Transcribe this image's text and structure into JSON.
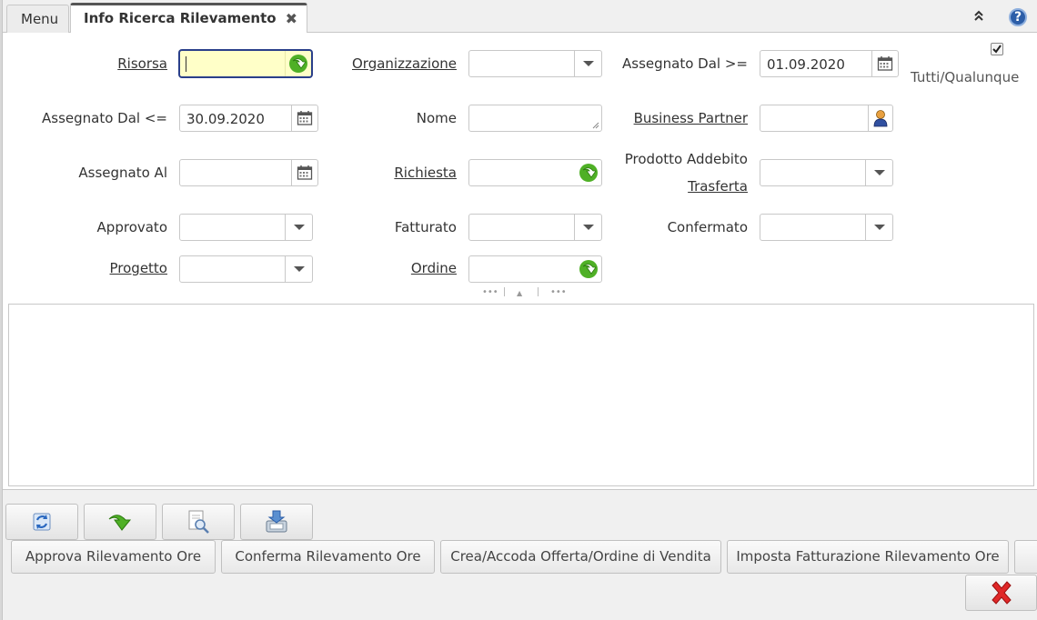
{
  "tabs": {
    "menu_label": "Menu",
    "active_label": "Info Ricerca Rilevamento Or...",
    "close_icon": "✖"
  },
  "help_label": "?",
  "form": {
    "risorsa_label": "Risorsa",
    "risorsa_value": "",
    "organizzazione_label": "Organizzazione",
    "organizzazione_value": "",
    "assegnato_dal_ge_label": "Assegnato Dal >=",
    "assegnato_dal_ge_value": "01.09.2020",
    "tutti_label": "Tutti/Qualunque",
    "tutti_checked": true,
    "assegnato_dal_le_label": "Assegnato Dal <=",
    "assegnato_dal_le_value": "30.09.2020",
    "nome_label": "Nome",
    "nome_value": "",
    "business_partner_label": "Business Partner",
    "business_partner_value": "",
    "assegnato_al_label": "Assegnato Al",
    "assegnato_al_value": "",
    "richiesta_label": "Richiesta",
    "richiesta_value": "",
    "prodotto_label_line1": "Prodotto Addebito",
    "prodotto_label_line2": "Trasferta",
    "prodotto_value": "",
    "approvato_label": "Approvato",
    "approvato_value": "",
    "fatturato_label": "Fatturato",
    "fatturato_value": "",
    "confermato_label": "Confermato",
    "confermato_value": "",
    "progetto_label": "Progetto",
    "progetto_value": "",
    "ordine_label": "Ordine",
    "ordine_value": ""
  },
  "splitter": {
    "left": "•••",
    "center": "▲",
    "right": "•••"
  },
  "processes": [
    "Approva Rilevamento Ore",
    "Conferma Rilevamento Ore",
    "Crea/Accoda Offerta/Ordine di Vendita",
    "Imposta Fatturazione Rilevamento Ore"
  ],
  "colors": {
    "focus_bg": "#ffffc8",
    "focus_border": "#2a3f8a",
    "green_arrow": "#3a9a1a",
    "cancel_red": "#d42020"
  }
}
